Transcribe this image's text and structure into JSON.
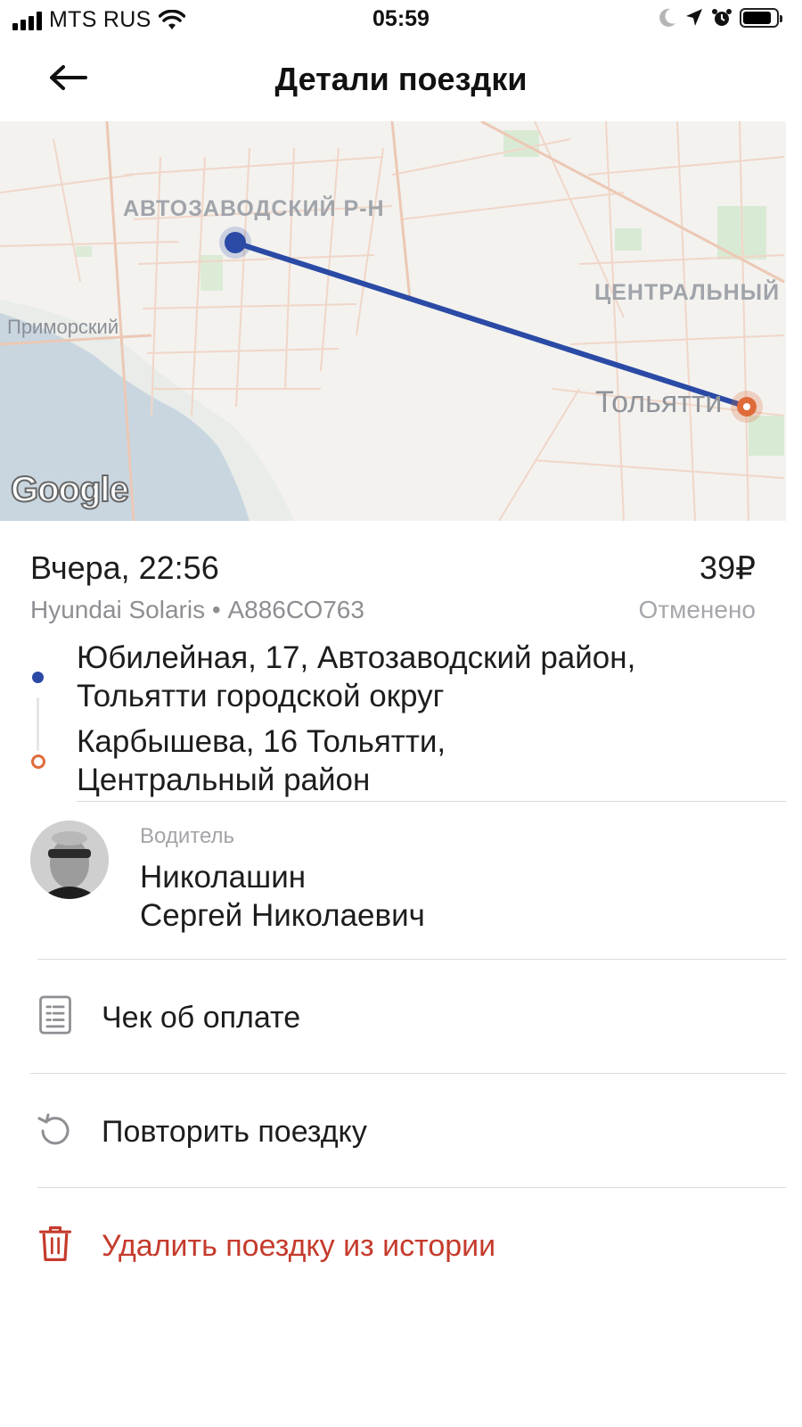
{
  "status_bar": {
    "carrier": "MTS RUS",
    "time": "05:59",
    "battery_level": 0.85,
    "icons": [
      "signal-icon",
      "wifi-icon",
      "moon-icon",
      "location-arrow-icon",
      "alarm-icon",
      "battery-icon"
    ]
  },
  "header": {
    "title": "Детали поездки",
    "back_icon": "arrow-left-icon"
  },
  "map": {
    "labels": {
      "district_avtozavodsky": "АВТОЗАВОДСКИЙ Р-Н",
      "district_central": "ЦЕНТРАЛЬНЫЙ",
      "primorsky": "Приморский",
      "city": "Тольятти"
    },
    "logo": "Google",
    "route_color": "#2a4aa5",
    "start_color": "#2a4aa5",
    "end_color": "#e06b3a"
  },
  "trip": {
    "datetime": "Вчера, 22:56",
    "price": "39₽",
    "car": "Hyundai Solaris • А886СО763",
    "status": "Отменено",
    "from_line1": "Юбилейная, 17, Автозаводский район,",
    "from_line2": "Тольятти городской округ",
    "to_line1": "Карбышева, 16 Тольятти,",
    "to_line2": "Центральный район"
  },
  "driver": {
    "caption": "Водитель",
    "name_line1": "Николашин",
    "name_line2": "Сергей Николаевич"
  },
  "actions": {
    "receipt": "Чек об оплате",
    "repeat": "Повторить поездку",
    "delete": "Удалить поездку из истории",
    "danger_color": "#c53b2c"
  }
}
